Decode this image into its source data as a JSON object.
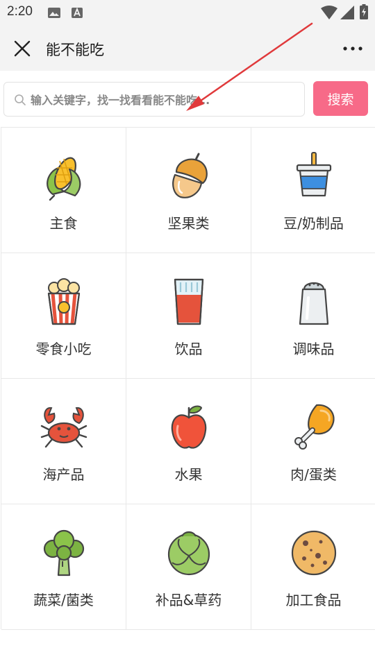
{
  "status": {
    "time": "2:20"
  },
  "header": {
    "title": "能不能吃"
  },
  "search": {
    "placeholder": "输入关键字，找一找看看能不能吃...",
    "button": "搜索"
  },
  "categories": [
    {
      "label": "主食",
      "icon": "corn-icon"
    },
    {
      "label": "坚果类",
      "icon": "acorn-icon"
    },
    {
      "label": "豆/奶制品",
      "icon": "yogurt-cup-icon"
    },
    {
      "label": "零食小吃",
      "icon": "popcorn-icon"
    },
    {
      "label": "饮品",
      "icon": "drink-glass-icon"
    },
    {
      "label": "调味品",
      "icon": "salt-shaker-icon"
    },
    {
      "label": "海产品",
      "icon": "crab-icon"
    },
    {
      "label": "水果",
      "icon": "apple-icon"
    },
    {
      "label": "肉/蛋类",
      "icon": "chicken-leg-icon"
    },
    {
      "label": "蔬菜/菌类",
      "icon": "broccoli-icon"
    },
    {
      "label": "补品&草药",
      "icon": "cabbage-icon"
    },
    {
      "label": "加工食品",
      "icon": "cookie-icon"
    }
  ],
  "colors": {
    "accent": "#f76a88",
    "annotation_arrow": "#e0393b"
  }
}
